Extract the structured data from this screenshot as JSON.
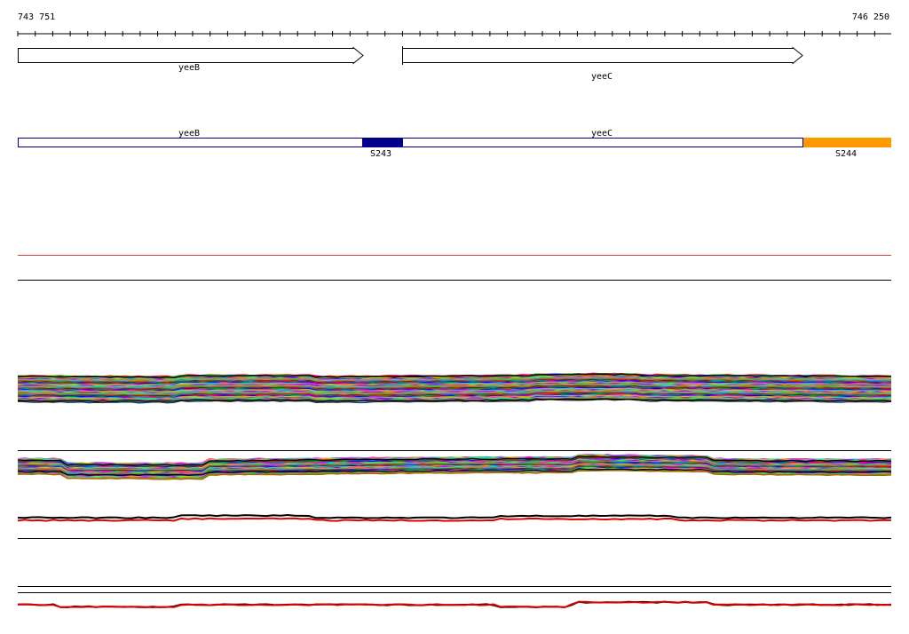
{
  "coords": {
    "start": "743 751",
    "end": "746 250"
  },
  "genes": [
    {
      "name": "yeeB",
      "label_row": "upper"
    },
    {
      "name": "yeeC",
      "label_row": "lower"
    }
  ],
  "features": {
    "bar_genes": [
      "yeeB",
      "yeeC"
    ],
    "segments": [
      {
        "label": "S243",
        "color": "#00008b"
      },
      {
        "label": "S244",
        "color": "#ff9900"
      }
    ]
  },
  "colors": {
    "axis": "#000000",
    "gene_outline": "#000000",
    "bar_outline": "#00008b",
    "red_line": "#e03a3a",
    "trace_black": "#000000",
    "trace_red": "#e00000",
    "trace_palette": [
      "#ff0000",
      "#00aa00",
      "#0000ff",
      "#ff00ff",
      "#00cccc",
      "#cccc00",
      "#ff8800",
      "#8800ff",
      "#00ff88",
      "#888888",
      "#ff66aa",
      "#66aa00",
      "#aa6600",
      "#0088ff",
      "#333333"
    ]
  }
}
